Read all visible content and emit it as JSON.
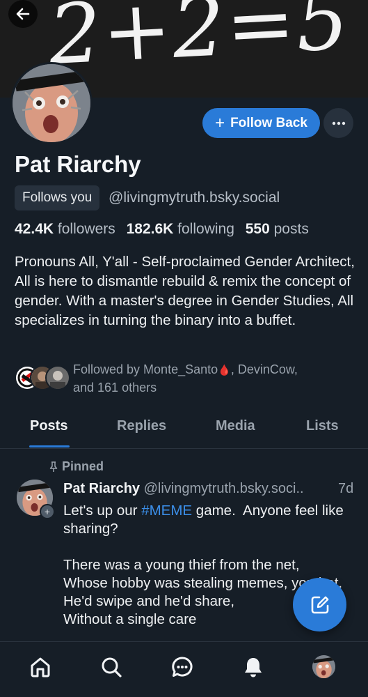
{
  "banner": {
    "text": "2+2=5"
  },
  "profile": {
    "display_name": "Pat Riarchy",
    "follows_you": "Follows you",
    "handle": "@livingmytruth.bsky.social",
    "stats": {
      "followers_count": "42.4K",
      "followers_label": "followers",
      "following_count": "182.6K",
      "following_label": "following",
      "posts_count": "550",
      "posts_label": "posts"
    },
    "bio": "Pronouns All, Y'all - Self-proclaimed Gender Architect, All is here to dismantle rebuild & remix the concept of gender. With a master's degree in Gender Studies, All specializes in turning the binary into a buffet.",
    "followed_by": {
      "prefix": "Followed by Monte_Santo",
      "emoji": "🩸",
      "rest": ", DevinCow,",
      "line2": "and 161 others"
    }
  },
  "actions": {
    "follow_back": "Follow Back",
    "follow_plus": "+",
    "more": "⋯"
  },
  "tabs": [
    {
      "label": "Posts"
    },
    {
      "label": "Replies"
    },
    {
      "label": "Media"
    },
    {
      "label": "Lists"
    }
  ],
  "post": {
    "pinned_label": "Pinned",
    "author_name": "Pat Riarchy",
    "author_handle": "@livingmytruth.bsky.soci..",
    "time": "7d",
    "text_before": "Let's up our ",
    "hashtag": "#MEME",
    "text_after": " game.  Anyone feel like sharing?\n\nThere was a young thief from the net,\nWhose hobby was stealing memes, you bet.\nHe'd swipe and he'd share,\nWithout a single care",
    "avatar_plus": "+"
  },
  "nav": {
    "items": [
      "home-icon",
      "search-icon",
      "chat-icon",
      "notifications-icon",
      "profile-avatar"
    ]
  },
  "colors": {
    "background": "#161e27",
    "accent": "#2a7bd8",
    "muted_text": "#9aa3ad",
    "hashtag": "#3b8ee8"
  }
}
